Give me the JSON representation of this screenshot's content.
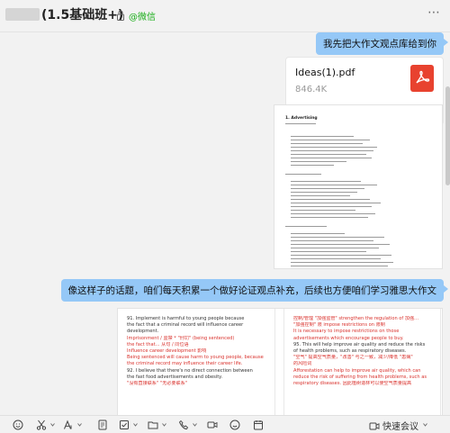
{
  "header": {
    "title": "(1.5基础班+)",
    "wechat_tag": "@微信"
  },
  "messages": {
    "msg1": "我先把大作文观点库给到你",
    "file": {
      "name": "Ideas(1).pdf",
      "size": "846.4K"
    },
    "doc1_title": "1. Advertising",
    "msg2": "像这样子的话题，咱们每天积累一个做好论证观点补充，后续也方便咱们学习雅思大作文"
  },
  "doc2": {
    "left_lines": [
      {
        "text": "91.    Implement is harmful to young people because",
        "color": "black"
      },
      {
        "text": "the fact that a criminal record will influence career",
        "color": "black"
      },
      {
        "text": "development.",
        "color": "black"
      },
      {
        "text": "Imprisonment / 监禁 * \"刑罚\" (being sentenced)",
        "color": "red"
      },
      {
        "text": "the fact that... 从句 / 同位语",
        "color": "red"
      },
      {
        "text": "Influence career development 影响",
        "color": "red"
      },
      {
        "text": "Being sentenced will cause harm to young people, because",
        "color": "red"
      },
      {
        "text": "the criminal record may influence their career life.",
        "color": "red"
      },
      {
        "text": "92.   I believe that there's no direct connection between",
        "color": "black"
      },
      {
        "text": "the fast food advertisements and obesity.",
        "color": "black"
      },
      {
        "text": "\"没有直接联系\" \"无必要联系\"",
        "color": "red"
      }
    ],
    "right_lines": [
      {
        "text": "控制/管理 \"加强监管\" strengthen the regulation of 加强…",
        "color": "red"
      },
      {
        "text": "\"加强控制\" 限 impose restrictions on 限制",
        "color": "red"
      },
      {
        "text": "It is necessary to impose restrictions on those",
        "color": "red"
      },
      {
        "text": "advertisements which encourage people to buy.",
        "color": "red"
      },
      {
        "text": "95.    This will help improve air quality and reduce the risks",
        "color": "black"
      },
      {
        "text": "of health problems, such as respiratory diseases.",
        "color": "black"
      },
      {
        "text": "\"空气\" 提高空气质量，\"改善\" 与之一致，减少/降低 \"患病\"",
        "color": "red"
      },
      {
        "text": "的风险词",
        "color": "red"
      },
      {
        "text": "Afforestation can help to improve air quality, which can",
        "color": "red"
      },
      {
        "text": "reduce the risk of suffering from health problems, such as",
        "color": "red"
      },
      {
        "text": "respiratory diseases. 因此植树造林可以使空气质量提高",
        "color": "red"
      }
    ]
  },
  "toolbar": {
    "meeting_label": "快速会议",
    "icons": [
      "emoji-icon",
      "scissors-icon",
      "font-icon",
      "file-icon",
      "screenshot-icon",
      "task-icon",
      "folder-icon",
      "phone-icon",
      "video-icon",
      "smiley-icon",
      "calendar-icon",
      "more-icon"
    ]
  }
}
